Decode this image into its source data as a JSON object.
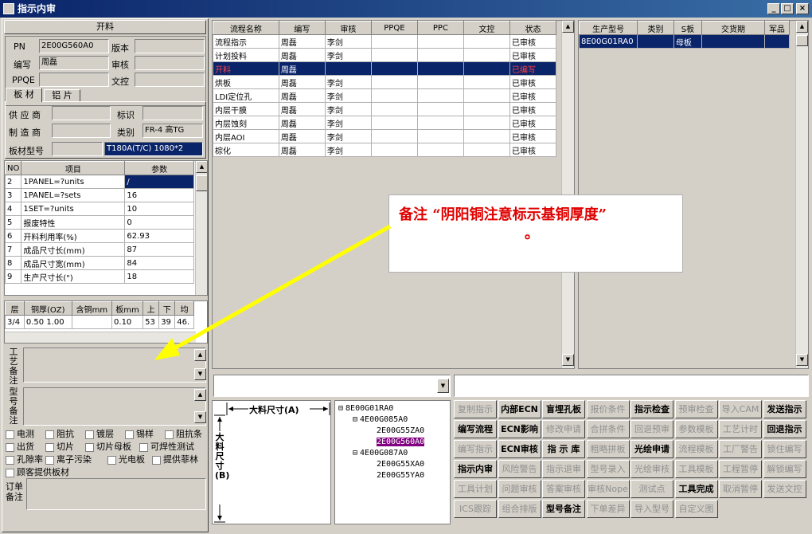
{
  "window": {
    "title": "指示内审",
    "min": "_",
    "max": "□",
    "close": "×"
  },
  "left": {
    "section_title": "开料",
    "pn_label": "PN",
    "pn_value": "2E00G560A0",
    "version_label": "版本",
    "version_value": "",
    "editor_label": "编写",
    "editor_value": "周磊",
    "review_label": "审核",
    "review_value": "",
    "ppqe_label": "PPQE",
    "ppqe_value": "",
    "doc_label": "文控",
    "doc_value": "",
    "tabs": [
      "板 材",
      "铝 片"
    ],
    "supplier_label": "供 应 商",
    "supplier_value": "",
    "mark_label": "标识",
    "mark_value": "",
    "maker_label": "制 造 商",
    "maker_value": "",
    "category_label": "类别",
    "category_value": "FR-4 高TG",
    "board_model_label": "板材型号",
    "board_model_value": "",
    "board_model_value2": "T180A(T/C) 1080*2",
    "param_table": {
      "headers": [
        "NO",
        "项目",
        "参数"
      ],
      "rows": [
        [
          "2",
          "1PANEL=?units",
          "/"
        ],
        [
          "3",
          "1PANEL=?sets",
          "16"
        ],
        [
          "4",
          "1SET=?units",
          "10"
        ],
        [
          "5",
          "报废特性",
          "0"
        ],
        [
          "6",
          "开料利用率(%)",
          "62.93"
        ],
        [
          "7",
          "成品尺寸长(mm)",
          "87"
        ],
        [
          "8",
          "成品尺寸宽(mm)",
          "84"
        ],
        [
          "9",
          "生产尺寸长(\")",
          "18"
        ]
      ]
    },
    "layer_table": {
      "headers": [
        "层",
        "铜厚(OZ)",
        "含铜mm",
        "板mm",
        "上",
        "下",
        "均"
      ],
      "rows": [
        [
          "3/4",
          "0.50 1.00",
          "",
          "0.10",
          "53",
          "39",
          "46."
        ]
      ]
    },
    "process_note_label": "工艺备注",
    "model_note_label": "型号备注",
    "checkboxes": [
      "电测",
      "阻抗",
      "镀层",
      "锡样",
      "阻抗条",
      "出货",
      "切片",
      "切片母板",
      "可焊性测试",
      "孔隙率",
      "离子污染",
      "光电板",
      "提供菲林",
      "顾客提供板材"
    ],
    "order_note_label": "订单备注"
  },
  "process_table": {
    "headers": [
      "流程名称",
      "编写",
      "审核",
      "PPQE",
      "PPC",
      "文控",
      "状态"
    ],
    "rows": [
      [
        "流程指示",
        "周磊",
        "李剑",
        "",
        "",
        "",
        "已审核"
      ],
      [
        "计划投料",
        "周磊",
        "李剑",
        "",
        "",
        "",
        "已审核"
      ],
      [
        "开料",
        "周磊",
        "",
        "",
        "",
        "",
        "已编写"
      ],
      [
        "烘板",
        "周磊",
        "李剑",
        "",
        "",
        "",
        "已审核"
      ],
      [
        "LDI定位孔",
        "周磊",
        "李剑",
        "",
        "",
        "",
        "已审核"
      ],
      [
        "内层干膜",
        "周磊",
        "李剑",
        "",
        "",
        "",
        "已审核"
      ],
      [
        "内层蚀刻",
        "周磊",
        "李剑",
        "",
        "",
        "",
        "已审核"
      ],
      [
        "内层AOI",
        "周磊",
        "李剑",
        "",
        "",
        "",
        "已审核"
      ],
      [
        "棕化",
        "周磊",
        "李剑",
        "",
        "",
        "",
        "已审核"
      ]
    ],
    "selected_index": 2
  },
  "model_table": {
    "headers": [
      "生产型号",
      "类别",
      "S板",
      "交货期",
      "军品"
    ],
    "rows": [
      [
        "8E00G01RA0",
        "",
        "母板",
        "",
        ""
      ]
    ]
  },
  "annotation": {
    "line1": "备注 “阴阳铜注意标示基铜厚度”",
    "line2": "。",
    "arrow_color": "#ffff00"
  },
  "dimension": {
    "a_label": "大料尺寸(A)",
    "b_label": "大料尺寸(B)"
  },
  "tree": [
    {
      "indent": 0,
      "toggle": "⊟",
      "text": "8E00G01RA0"
    },
    {
      "indent": 1,
      "toggle": "⊟",
      "text": "4E00G085A0"
    },
    {
      "indent": 2,
      "toggle": "",
      "text": "2E00G55ZA0"
    },
    {
      "indent": 2,
      "toggle": "",
      "text": "2E00G560A0",
      "selected": true
    },
    {
      "indent": 1,
      "toggle": "⊟",
      "text": "4E00G087A0"
    },
    {
      "indent": 2,
      "toggle": "",
      "text": "2E00G55XA0"
    },
    {
      "indent": 2,
      "toggle": "",
      "text": "2E00G55YA0"
    }
  ],
  "buttons": [
    [
      {
        "label": "复制指示",
        "en": false
      },
      {
        "label": "内部ECN",
        "en": true
      },
      {
        "label": "盲埋孔板",
        "en": true
      },
      {
        "label": "报价条件",
        "en": false
      },
      {
        "label": "指示检查",
        "en": true
      },
      {
        "label": "预审检查",
        "en": false
      },
      {
        "label": "导入CAM",
        "en": false
      },
      {
        "label": "发送指示",
        "en": true
      }
    ],
    [
      {
        "label": "编写流程",
        "en": true
      },
      {
        "label": "ECN影响",
        "en": true
      },
      {
        "label": "修改申请",
        "en": false
      },
      {
        "label": "合拼条件",
        "en": false
      },
      {
        "label": "回退预审",
        "en": false
      },
      {
        "label": "参数模板",
        "en": false
      },
      {
        "label": "工艺计时",
        "en": false
      },
      {
        "label": "回退指示",
        "en": true
      }
    ],
    [
      {
        "label": "编写指示",
        "en": false
      },
      {
        "label": "ECN审核",
        "en": true
      },
      {
        "label": "指 示 库",
        "en": true
      },
      {
        "label": "粗略拼板",
        "en": false
      },
      {
        "label": "光绘申请",
        "en": true
      },
      {
        "label": "流程模板",
        "en": false
      },
      {
        "label": "工厂警告",
        "en": false
      },
      {
        "label": "锁住编写",
        "en": false
      }
    ],
    [
      {
        "label": "指示内审",
        "en": true
      },
      {
        "label": "风险警告",
        "en": false
      },
      {
        "label": "指示退审",
        "en": false
      },
      {
        "label": "型号录入",
        "en": false
      },
      {
        "label": "光绘审核",
        "en": false
      },
      {
        "label": "工具模板",
        "en": false
      },
      {
        "label": "工程暂停",
        "en": false
      },
      {
        "label": "解锁编写",
        "en": false
      }
    ],
    [
      {
        "label": "工具计划",
        "en": false
      },
      {
        "label": "问题审核",
        "en": false
      },
      {
        "label": "答案审核",
        "en": false
      },
      {
        "label": "审核Nope",
        "en": false
      },
      {
        "label": "测试点",
        "en": false
      },
      {
        "label": "工具完成",
        "en": true
      },
      {
        "label": "取消暂停",
        "en": false
      },
      {
        "label": "发送文控",
        "en": false
      }
    ],
    [
      {
        "label": "ICS跟踪",
        "en": false
      },
      {
        "label": "组合排版",
        "en": false
      },
      {
        "label": "型号备注",
        "en": true
      },
      {
        "label": "下单差异",
        "en": false
      },
      {
        "label": "导入型号",
        "en": false
      },
      {
        "label": "自定义图",
        "en": false
      }
    ]
  ]
}
